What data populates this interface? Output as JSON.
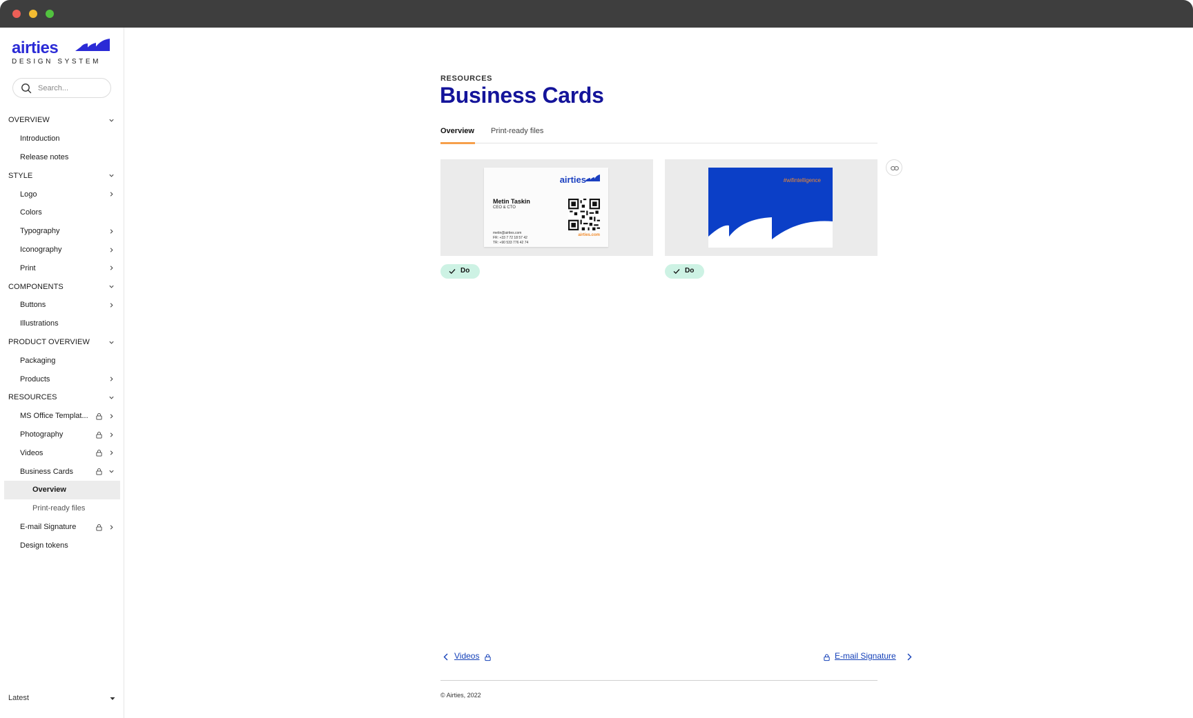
{
  "brand": {
    "wordmark": "airties",
    "subtitle": "DESIGN SYSTEM"
  },
  "search": {
    "placeholder": "Search..."
  },
  "nav": {
    "overview": {
      "label": "OVERVIEW",
      "items": [
        "Introduction",
        "Release notes"
      ]
    },
    "style": {
      "label": "STYLE",
      "items": [
        "Logo",
        "Colors",
        "Typography",
        "Iconography",
        "Print"
      ]
    },
    "components": {
      "label": "COMPONENTS",
      "items": [
        "Buttons",
        "Illustrations"
      ]
    },
    "product_overview": {
      "label": "PRODUCT OVERVIEW",
      "items": [
        "Packaging",
        "Products"
      ]
    },
    "resources": {
      "label": "RESOURCES",
      "items": [
        "MS Office Templat...",
        "Photography",
        "Videos",
        "Business Cards",
        "E-mail Signature",
        "Design tokens"
      ],
      "business_cards_sub": [
        "Overview",
        "Print-ready files"
      ]
    }
  },
  "version": {
    "label": "Latest"
  },
  "page": {
    "eyebrow": "RESOURCES",
    "title": "Business Cards",
    "tabs": [
      "Overview",
      "Print-ready files"
    ]
  },
  "cards": {
    "front": {
      "logo": "airties",
      "name": "Metin Taskin",
      "role": "CEO & CTO",
      "email": "metin@airties.com",
      "phone_fr": "FR: +33 7 72 18 57 42",
      "phone_tr": "TR: +90 533 776 42 74",
      "url": "airties.com"
    },
    "back": {
      "hashtag": "#wifintelligence"
    },
    "badge_label": "Do"
  },
  "pager": {
    "prev": "Videos",
    "next": "E-mail Signature"
  },
  "footer": {
    "copyright": "© Airties, 2022"
  },
  "colors": {
    "brand": "#14149a",
    "accent": "#f6a04b",
    "badge": "#cdf2e4",
    "link": "#1440b8",
    "card_blue": "#0b3fc7"
  }
}
